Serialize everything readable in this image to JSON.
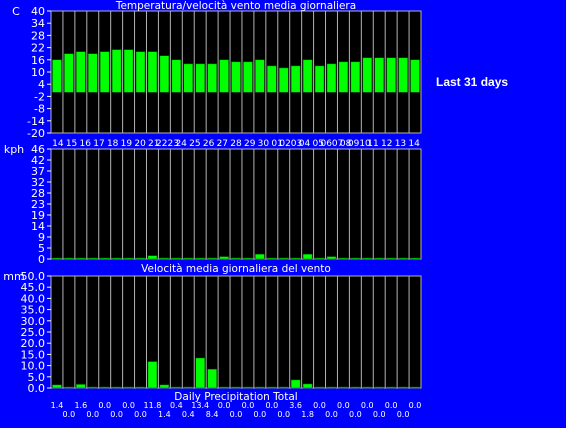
{
  "side_label": "Last 31 days",
  "colors": {
    "background": "#0000ff",
    "panel": "#000000",
    "bar": "#00ff00",
    "grid": "#b4b4b4",
    "text": "#ffffff"
  },
  "chart_data": [
    {
      "type": "bar",
      "title": "Temperatura/velocità vento media giornaliera",
      "ylabel": "C",
      "ylim": [
        -20,
        40
      ],
      "yticks": [
        "40",
        "34",
        "28",
        "22",
        "16",
        "10",
        "4",
        "-2",
        "-8",
        "-14",
        "-20"
      ],
      "categories": [
        "14",
        "15",
        "16",
        "17",
        "18",
        "19",
        "20",
        "21",
        "22",
        "23",
        "24",
        "25",
        "26",
        "27",
        "28",
        "29",
        "30",
        "01",
        "02",
        "03",
        "04",
        "05",
        "06",
        "07",
        "08",
        "09",
        "10",
        "11",
        "12",
        "13",
        "14"
      ],
      "x_tick_labels": [
        "14",
        "15",
        "16",
        "17",
        "18",
        "19",
        "20",
        "21",
        "2223",
        "24",
        "25",
        "26",
        "27",
        "28",
        "29",
        "30",
        "01",
        "0203",
        "04",
        "05",
        "0607",
        "08",
        "0910",
        "11",
        "12",
        "13",
        "14"
      ],
      "values": [
        16,
        19,
        20,
        19,
        20,
        21,
        21,
        20,
        20,
        18,
        16,
        14,
        14,
        14,
        16,
        15,
        15,
        16,
        13,
        12,
        13,
        16,
        13,
        14,
        15,
        15,
        17,
        17,
        17,
        17,
        16
      ],
      "grid": true
    },
    {
      "type": "bar",
      "title": "",
      "ylabel": "kph",
      "ylim": [
        0,
        46
      ],
      "yticks": [
        "46",
        "42",
        "37",
        "32",
        "28",
        "23",
        "19",
        "14",
        "9",
        "5",
        "0"
      ],
      "categories": [
        "14",
        "15",
        "16",
        "17",
        "18",
        "19",
        "20",
        "21",
        "22",
        "23",
        "24",
        "25",
        "26",
        "27",
        "28",
        "29",
        "30",
        "01",
        "02",
        "03",
        "04",
        "05",
        "06",
        "07",
        "08",
        "09",
        "10",
        "11",
        "12",
        "13",
        "14"
      ],
      "values": [
        0.4,
        0.4,
        0.4,
        0.4,
        0.4,
        0.4,
        0.4,
        0.4,
        1.4,
        0.4,
        0.4,
        0.4,
        0.4,
        0.4,
        1,
        0.4,
        0.4,
        2,
        0.4,
        0.4,
        0.4,
        2,
        0.4,
        1,
        0.4,
        0.4,
        0.4,
        0.4,
        0.4,
        0.4,
        0.4
      ],
      "grid": true
    },
    {
      "type": "bar",
      "title": "Velocità media giornaliera del vento",
      "xlabel": "Daily Precipitation Total",
      "ylabel": "mm",
      "ylim": [
        0,
        50
      ],
      "yticks": [
        "50.0",
        "45.0",
        "40.0",
        "35.0",
        "30.0",
        "25.0",
        "20.0",
        "15.0",
        "10.0",
        "5.0",
        "0.0"
      ],
      "categories": [
        "14",
        "15",
        "16",
        "17",
        "18",
        "19",
        "20",
        "21",
        "22",
        "23",
        "24",
        "25",
        "26",
        "27",
        "28",
        "29",
        "30",
        "01",
        "02",
        "03",
        "04",
        "05",
        "06",
        "07",
        "08",
        "09",
        "10",
        "11",
        "12",
        "13",
        "14"
      ],
      "values": [
        1.4,
        0.0,
        1.6,
        0.0,
        0.0,
        0.0,
        0.0,
        0.0,
        11.8,
        1.4,
        0.4,
        0.4,
        13.4,
        8.4,
        0.0,
        0.0,
        0.0,
        0.0,
        0.0,
        0.0,
        3.6,
        1.8,
        0.0,
        0.0,
        0.0,
        0.0,
        0.0,
        0.0,
        0.0,
        0.0,
        0.0
      ],
      "value_labels": [
        "1.4",
        "0.0",
        "1.6",
        "0.0",
        "0.0",
        "0.0",
        "0.0",
        "0.0",
        "11.8",
        "1.4",
        "0.4",
        "0.4",
        "13.4",
        "8.4",
        "0.0",
        "0.0",
        "0.0",
        "0.0",
        "0.0",
        "0.0",
        "3.6",
        "1.8",
        "0.0",
        "0.0",
        "0.0",
        "0.0",
        "0.0",
        "0.0",
        "0.0",
        "0.0",
        "0.0"
      ],
      "grid": true
    }
  ]
}
